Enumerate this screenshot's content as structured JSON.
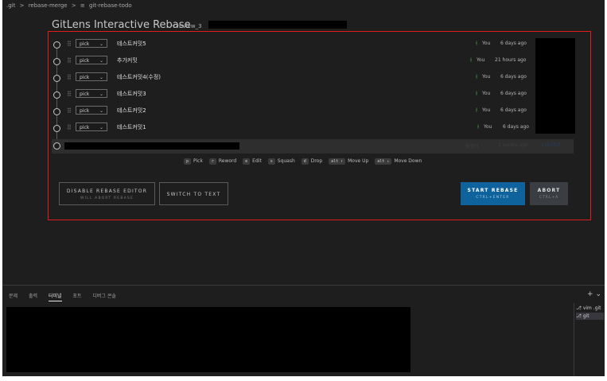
{
  "breadcrumb": [
    ".git",
    ">",
    "rebase-merge",
    ">",
    "≡",
    "git-rebase-todo"
  ],
  "header": {
    "title": "GitLens Interactive Rebase",
    "branch_icon": "git-branch-icon",
    "branch": "review_3"
  },
  "commits": [
    {
      "action": "pick",
      "message": "테스트커밋5",
      "author": "You",
      "date": "6 days ago"
    },
    {
      "action": "pick",
      "message": "추가커밋",
      "author": "You",
      "date": "21 hours ago"
    },
    {
      "action": "pick",
      "message": "테스트커밋4(수정)",
      "author": "You",
      "date": "6 days ago"
    },
    {
      "action": "pick",
      "message": "테스트커밋3",
      "author": "You",
      "date": "6 days ago"
    },
    {
      "action": "pick",
      "message": "테스트커밋2",
      "author": "You",
      "date": "6 days ago"
    },
    {
      "action": "pick",
      "message": "테스트커밋1",
      "author": "You",
      "date": "6 days ago"
    }
  ],
  "onto": {
    "author": "최정아",
    "date": "2 weeks ago",
    "sha": "1ab0f27"
  },
  "shortcuts": [
    {
      "key": "p",
      "label": "Pick"
    },
    {
      "key": "r",
      "label": "Reword"
    },
    {
      "key": "e",
      "label": "Edit"
    },
    {
      "key": "s",
      "label": "Squash"
    },
    {
      "key": "d",
      "label": "Drop"
    },
    {
      "key": "alt ↑",
      "label": "Move Up"
    },
    {
      "key": "alt ↓",
      "label": "Move Down"
    }
  ],
  "buttons": {
    "disable": {
      "label": "DISABLE REBASE EDITOR",
      "sub": "WILL ABORT REBASE"
    },
    "switch": {
      "label": "SWITCH TO TEXT"
    },
    "start": {
      "label": "START REBASE",
      "sub": "CTRL+ENTER"
    },
    "abort": {
      "label": "ABORT",
      "sub": "CTRL+A"
    }
  },
  "panel": {
    "tabs": [
      "문제",
      "출력",
      "터미널",
      "포트",
      "디버그 콘솔"
    ],
    "active_tab": "터미널",
    "actions": "+ ⌄",
    "terminals": [
      "vim .git",
      "git"
    ]
  },
  "colors": {
    "highlight_border": "#e51b1b",
    "start_button": "#0e639c",
    "author_icon": "#3fb950"
  }
}
